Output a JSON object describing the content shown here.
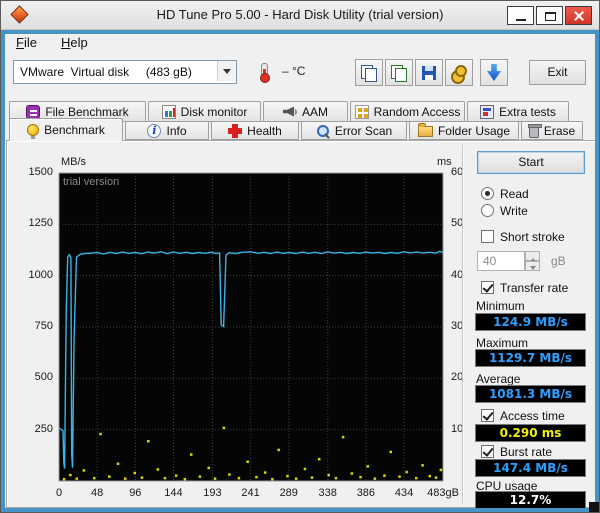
{
  "window": {
    "title": "HD Tune Pro 5.00 - Hard Disk Utility (trial version)"
  },
  "menu": {
    "file": "File",
    "help": "Help"
  },
  "toolbar": {
    "disk_select": "VMware  Virtual disk     (483 gB)",
    "temperature": "– °C",
    "exit": "Exit"
  },
  "tabs": {
    "row1": [
      "File Benchmark",
      "Disk monitor",
      "AAM",
      "Random Access",
      "Extra tests"
    ],
    "row2": [
      "Benchmark",
      "Info",
      "Health",
      "Error Scan",
      "Folder Usage",
      "Erase"
    ],
    "active": "Benchmark"
  },
  "panel": {
    "start": "Start",
    "read": "Read",
    "write": "Write",
    "short_stroke": "Short stroke",
    "short_stroke_value": "40",
    "gb_unit": "gB",
    "transfer_rate": "Transfer rate",
    "minimum_label": "Minimum",
    "minimum_value": "124.9 MB/s",
    "maximum_label": "Maximum",
    "maximum_value": "1129.7 MB/s",
    "average_label": "Average",
    "average_value": "1081.3 MB/s",
    "access_time": "Access time",
    "access_time_value": "0.290 ms",
    "burst_rate": "Burst rate",
    "burst_rate_value": "147.4 MB/s",
    "cpu_usage_label": "CPU usage",
    "cpu_usage_value": "12.7%"
  },
  "chart_data": {
    "type": "line",
    "watermark": "trial version",
    "y_left_label": "MB/s",
    "y_right_label": "ms",
    "y_left_ticks": [
      1500,
      1250,
      1000,
      750,
      500,
      250
    ],
    "y_right_ticks": [
      60,
      50,
      40,
      30,
      20,
      10
    ],
    "x_ticks": [
      "0",
      "48",
      "96",
      "144",
      "193",
      "241",
      "289",
      "338",
      "386",
      "434",
      "483gB"
    ],
    "x_tick_values": [
      0,
      48,
      96,
      144,
      193,
      241,
      289,
      338,
      386,
      434,
      483
    ],
    "x_range": [
      0,
      483
    ],
    "y_left_range": [
      0,
      1500
    ],
    "y_right_range": [
      0,
      60
    ],
    "legend": [
      {
        "name": "Transfer rate",
        "color": "#3ab4e8"
      },
      {
        "name": "Access time",
        "color": "#d8d800"
      }
    ],
    "colors": {
      "transfer_rate": "#3ab4e8",
      "access_time": "#d8d800",
      "grid": "#3a423a",
      "background": "#050505"
    },
    "transfer_rate_series": [
      [
        0,
        258
      ],
      [
        3,
        250
      ],
      [
        5,
        245
      ],
      [
        6,
        90
      ],
      [
        7,
        60
      ],
      [
        9,
        820
      ],
      [
        11,
        1090
      ],
      [
        13,
        1102
      ],
      [
        15,
        1088
      ],
      [
        16,
        130
      ],
      [
        17,
        65
      ],
      [
        19,
        700
      ],
      [
        22,
        1090
      ],
      [
        26,
        1102
      ],
      [
        32,
        1108
      ],
      [
        40,
        1110
      ],
      [
        48,
        1112
      ],
      [
        56,
        1106
      ],
      [
        64,
        1114
      ],
      [
        72,
        1108
      ],
      [
        80,
        1115
      ],
      [
        88,
        1109
      ],
      [
        96,
        1113
      ],
      [
        104,
        1107
      ],
      [
        112,
        1115
      ],
      [
        120,
        1110
      ],
      [
        128,
        1116
      ],
      [
        136,
        1108
      ],
      [
        144,
        1115
      ],
      [
        152,
        1109
      ],
      [
        160,
        1114
      ],
      [
        168,
        1108
      ],
      [
        176,
        1113
      ],
      [
        184,
        1109
      ],
      [
        192,
        1114
      ],
      [
        198,
        1108
      ],
      [
        202,
        1110
      ],
      [
        204,
        760
      ],
      [
        207,
        752
      ],
      [
        210,
        1100
      ],
      [
        214,
        1112
      ],
      [
        222,
        1108
      ],
      [
        230,
        1114
      ],
      [
        241,
        1116
      ],
      [
        250,
        1109
      ],
      [
        258,
        1114
      ],
      [
        266,
        1108
      ],
      [
        274,
        1115
      ],
      [
        282,
        1109
      ],
      [
        289,
        1113
      ],
      [
        298,
        1108
      ],
      [
        306,
        1115
      ],
      [
        314,
        1109
      ],
      [
        322,
        1114
      ],
      [
        330,
        1108
      ],
      [
        338,
        1116
      ],
      [
        346,
        1110
      ],
      [
        354,
        1114
      ],
      [
        362,
        1108
      ],
      [
        370,
        1113
      ],
      [
        378,
        1109
      ],
      [
        386,
        1115
      ],
      [
        394,
        1110
      ],
      [
        402,
        1114
      ],
      [
        410,
        1108
      ],
      [
        418,
        1113
      ],
      [
        426,
        1109
      ],
      [
        434,
        1116
      ],
      [
        442,
        1111
      ],
      [
        450,
        1115
      ],
      [
        458,
        1110
      ],
      [
        466,
        1114
      ],
      [
        474,
        1110
      ],
      [
        479,
        1118
      ],
      [
        483,
        1113
      ]
    ],
    "access_time_points_ms": [
      [
        6,
        0.4
      ],
      [
        14,
        1.2
      ],
      [
        22,
        0.5
      ],
      [
        31,
        2.1
      ],
      [
        44,
        0.6
      ],
      [
        52,
        9.2
      ],
      [
        63,
        0.9
      ],
      [
        74,
        3.4
      ],
      [
        83,
        0.5
      ],
      [
        95,
        1.6
      ],
      [
        104,
        0.7
      ],
      [
        112,
        7.8
      ],
      [
        124,
        2.3
      ],
      [
        133,
        0.6
      ],
      [
        147,
        1.1
      ],
      [
        158,
        0.4
      ],
      [
        166,
        5.2
      ],
      [
        177,
        0.9
      ],
      [
        188,
        2.6
      ],
      [
        196,
        0.5
      ],
      [
        207,
        10.4
      ],
      [
        214,
        1.3
      ],
      [
        226,
        0.6
      ],
      [
        237,
        3.8
      ],
      [
        248,
        0.8
      ],
      [
        259,
        1.7
      ],
      [
        268,
        0.4
      ],
      [
        276,
        6.1
      ],
      [
        287,
        1.0
      ],
      [
        298,
        0.5
      ],
      [
        309,
        2.4
      ],
      [
        318,
        0.7
      ],
      [
        327,
        4.3
      ],
      [
        339,
        1.2
      ],
      [
        348,
        0.6
      ],
      [
        357,
        8.6
      ],
      [
        368,
        1.5
      ],
      [
        379,
        0.8
      ],
      [
        388,
        2.9
      ],
      [
        397,
        0.5
      ],
      [
        409,
        1.1
      ],
      [
        417,
        5.7
      ],
      [
        428,
        0.9
      ],
      [
        437,
        1.8
      ],
      [
        449,
        0.6
      ],
      [
        457,
        3.1
      ],
      [
        466,
        1.0
      ],
      [
        474,
        0.7
      ],
      [
        480,
        2.2
      ]
    ]
  }
}
